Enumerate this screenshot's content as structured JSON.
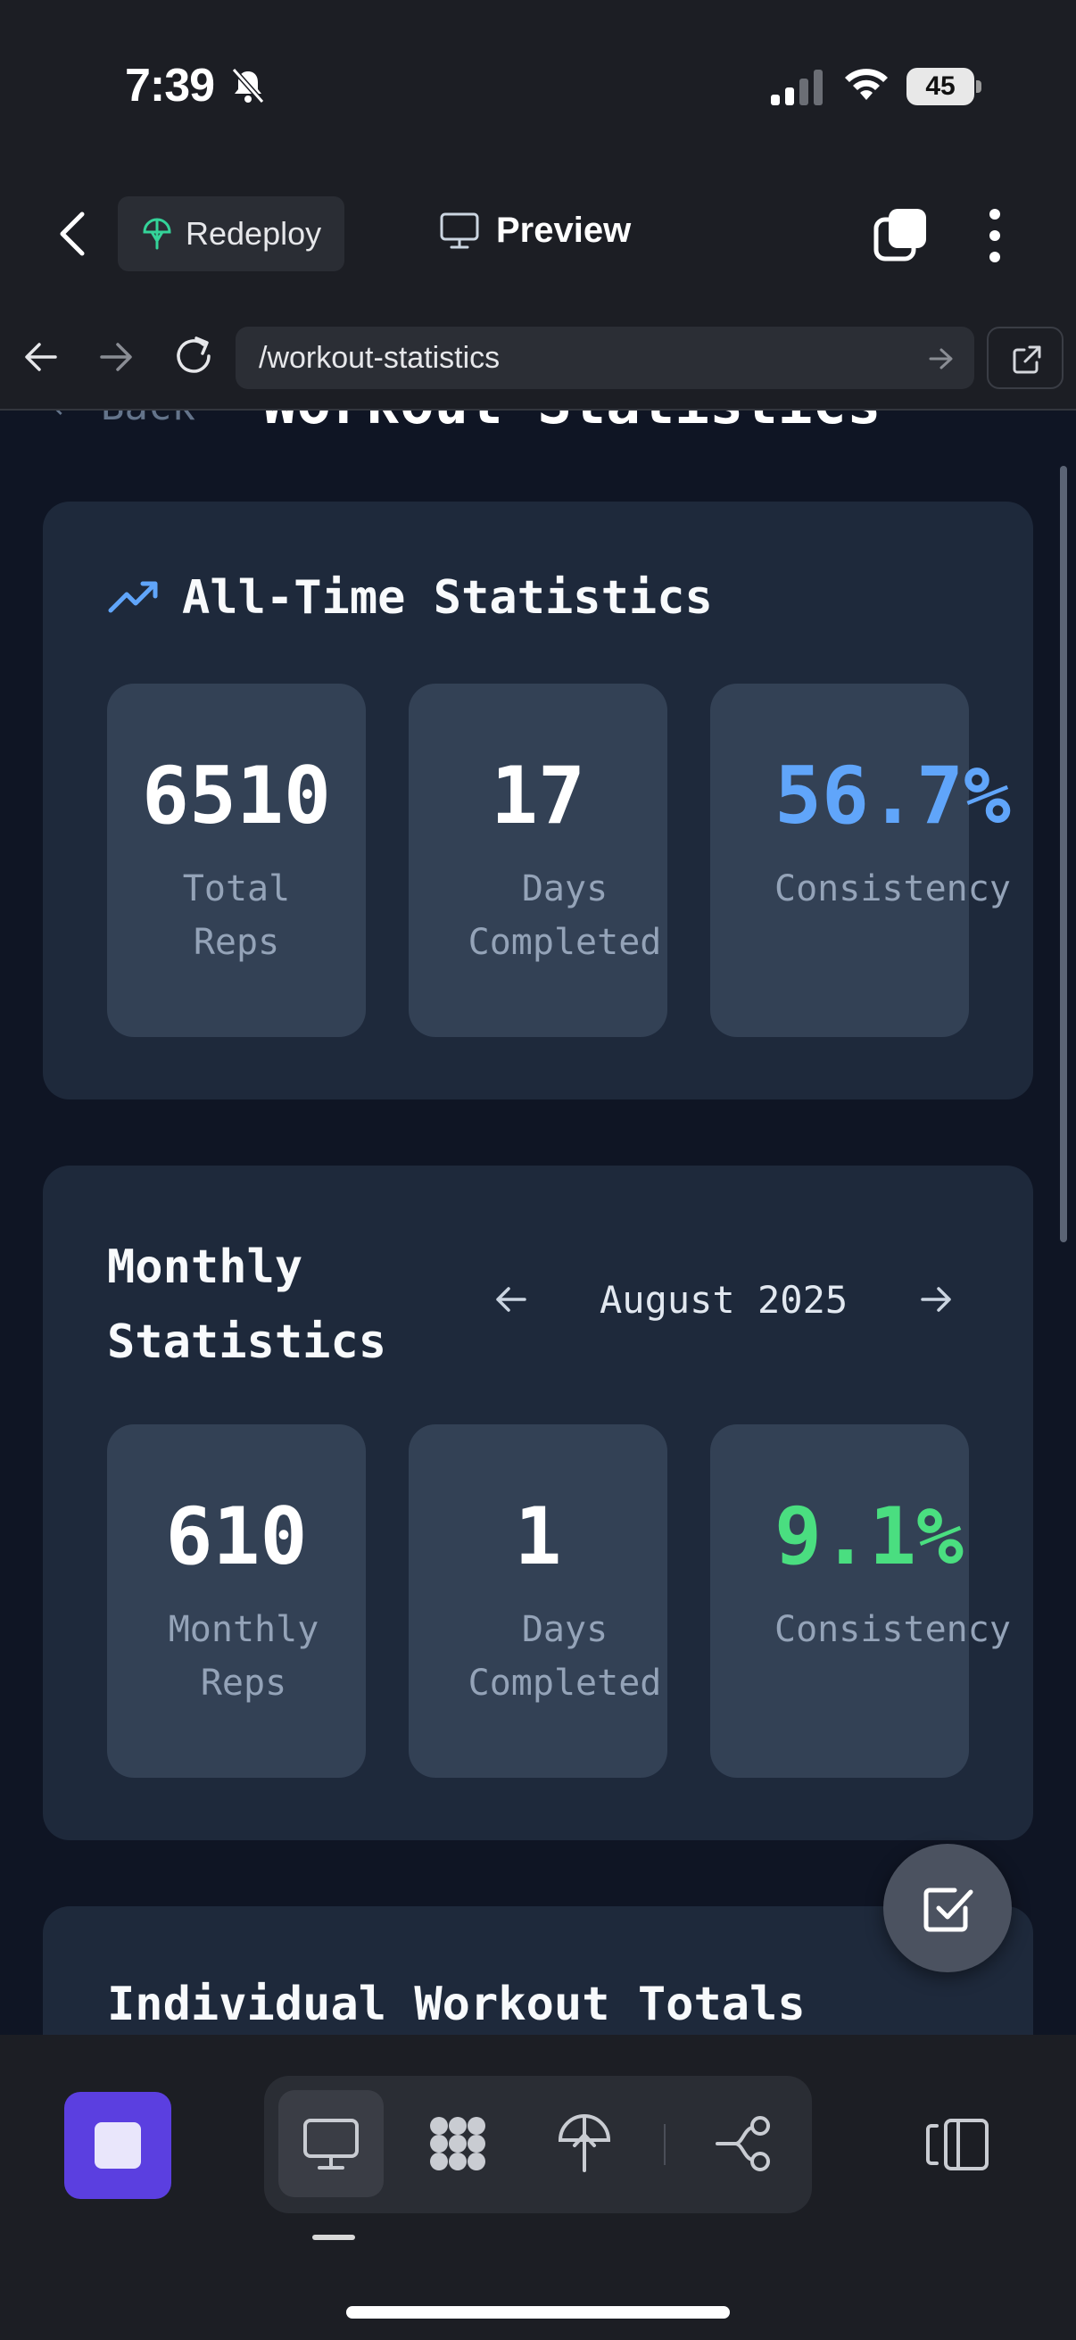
{
  "status_bar": {
    "time": "7:39",
    "battery_level": "45",
    "battery_fraction": 0.45
  },
  "app_header": {
    "redeploy_label": "Redeploy",
    "preview_label": "Preview"
  },
  "browser": {
    "url": "/workout-statistics"
  },
  "page": {
    "title": "Workout Statistics",
    "back_label": "← Back",
    "all_time": {
      "title": "All-Time Statistics",
      "stats": [
        {
          "value": "6510",
          "label": "Total\nReps",
          "color": "#ffffff"
        },
        {
          "value": "17",
          "label": "Days\nCompleted",
          "color": "#ffffff"
        },
        {
          "value": "56.7%",
          "label": "Consistency",
          "color": "#60a5fa"
        }
      ]
    },
    "monthly": {
      "title_line1": "Monthly",
      "title_line2": "Statistics",
      "month": "August 2025",
      "stats": [
        {
          "value": "610",
          "label": "Monthly\nReps",
          "color": "#ffffff"
        },
        {
          "value": "1",
          "label": "Days\nCompleted",
          "color": "#ffffff"
        },
        {
          "value": "9.1%",
          "label": "Consistency",
          "color": "#4ade80"
        }
      ]
    },
    "individual": {
      "title": "Individual Workout Totals"
    }
  },
  "colors": {
    "accent_blue": "#60a5fa",
    "accent_green": "#4ade80",
    "stop_button": "#5b3fe0",
    "card_bg": "#1e293b",
    "stat_bg": "#334155"
  },
  "icons": {
    "back": "chevron-left-icon",
    "redeploy": "redeploy-icon",
    "preview": "monitor-icon",
    "tabs": "tabs-icon",
    "menu": "kebab-menu-icon",
    "trend": "trending-up-icon",
    "fab": "checkbox-icon"
  }
}
